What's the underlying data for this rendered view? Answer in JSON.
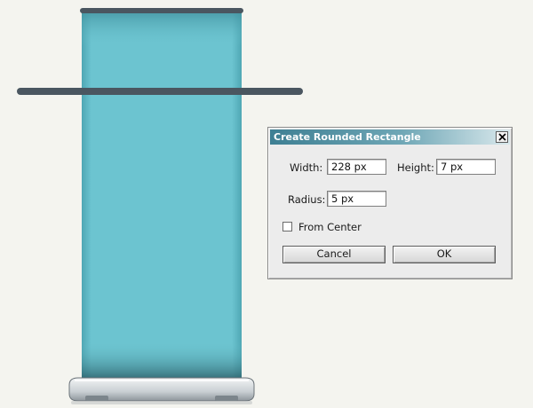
{
  "dialog": {
    "title": "Create Rounded Rectangle",
    "close_icon": "close-x-icon",
    "width_label": "Width:",
    "width_value": "228 px",
    "height_label": "Height:",
    "height_value": "7 px",
    "radius_label": "Radius:",
    "radius_value": "5 px",
    "from_center_label": "From Center",
    "from_center_checked": false,
    "cancel_label": "Cancel",
    "ok_label": "OK"
  },
  "colors": {
    "banner_fill": "#6cc4d0",
    "rod_color": "#4a5660",
    "title_gradient_start": "#3e7f93"
  }
}
